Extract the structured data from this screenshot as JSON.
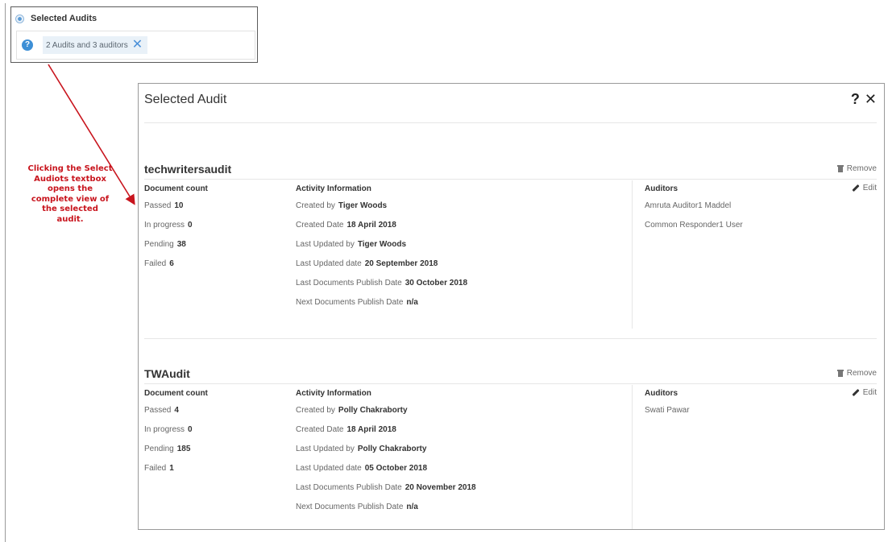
{
  "selector": {
    "title": "Selected Audits",
    "chip_text": "2 Audits and 3 auditors",
    "chip_remove": "✕",
    "help_glyph": "?"
  },
  "annotation": {
    "lines": [
      "Clicking the Select",
      "Audiots textbox",
      "opens the",
      "complete view of",
      "the selected",
      "audit."
    ],
    "color": "#c8141d"
  },
  "dialog": {
    "title": "Selected Audit",
    "help_glyph": "?",
    "close_glyph": "✕",
    "remove_label": "Remove",
    "edit_label": "Edit",
    "doc_heading": "Document count",
    "activity_heading": "Activity Information",
    "auditors_heading": "Auditors",
    "audits": [
      {
        "name": "techwritersaudit",
        "documents": [
          {
            "label": "Passed",
            "value": "10"
          },
          {
            "label": "In progress",
            "value": "0"
          },
          {
            "label": "Pending",
            "value": "38"
          },
          {
            "label": "Failed",
            "value": "6"
          }
        ],
        "activity": [
          {
            "label": "Created by",
            "value": "Tiger Woods"
          },
          {
            "label": "Created Date",
            "value": "18 April 2018"
          },
          {
            "label": "Last Updated by",
            "value": "Tiger Woods"
          },
          {
            "label": "Last Updated date",
            "value": "20 September 2018"
          },
          {
            "label": "Last Documents Publish Date",
            "value": "30 October 2018"
          },
          {
            "label": "Next Documents Publish Date",
            "value": "n/a"
          }
        ],
        "auditors": [
          "Amruta Auditor1 Maddel",
          "Common Responder1 User"
        ]
      },
      {
        "name": "TWAudit",
        "documents": [
          {
            "label": "Passed",
            "value": "4"
          },
          {
            "label": "In progress",
            "value": "0"
          },
          {
            "label": "Pending",
            "value": "185"
          },
          {
            "label": "Failed",
            "value": "1"
          }
        ],
        "activity": [
          {
            "label": "Created by",
            "value": "Polly Chakraborty"
          },
          {
            "label": "Created Date",
            "value": "18 April 2018"
          },
          {
            "label": "Last Updated by",
            "value": "Polly Chakraborty"
          },
          {
            "label": "Last Updated date",
            "value": "05 October 2018"
          },
          {
            "label": "Last Documents Publish Date",
            "value": "20 November 2018"
          },
          {
            "label": "Next Documents Publish Date",
            "value": "n/a"
          }
        ],
        "auditors": [
          "Swati Pawar"
        ]
      }
    ]
  }
}
